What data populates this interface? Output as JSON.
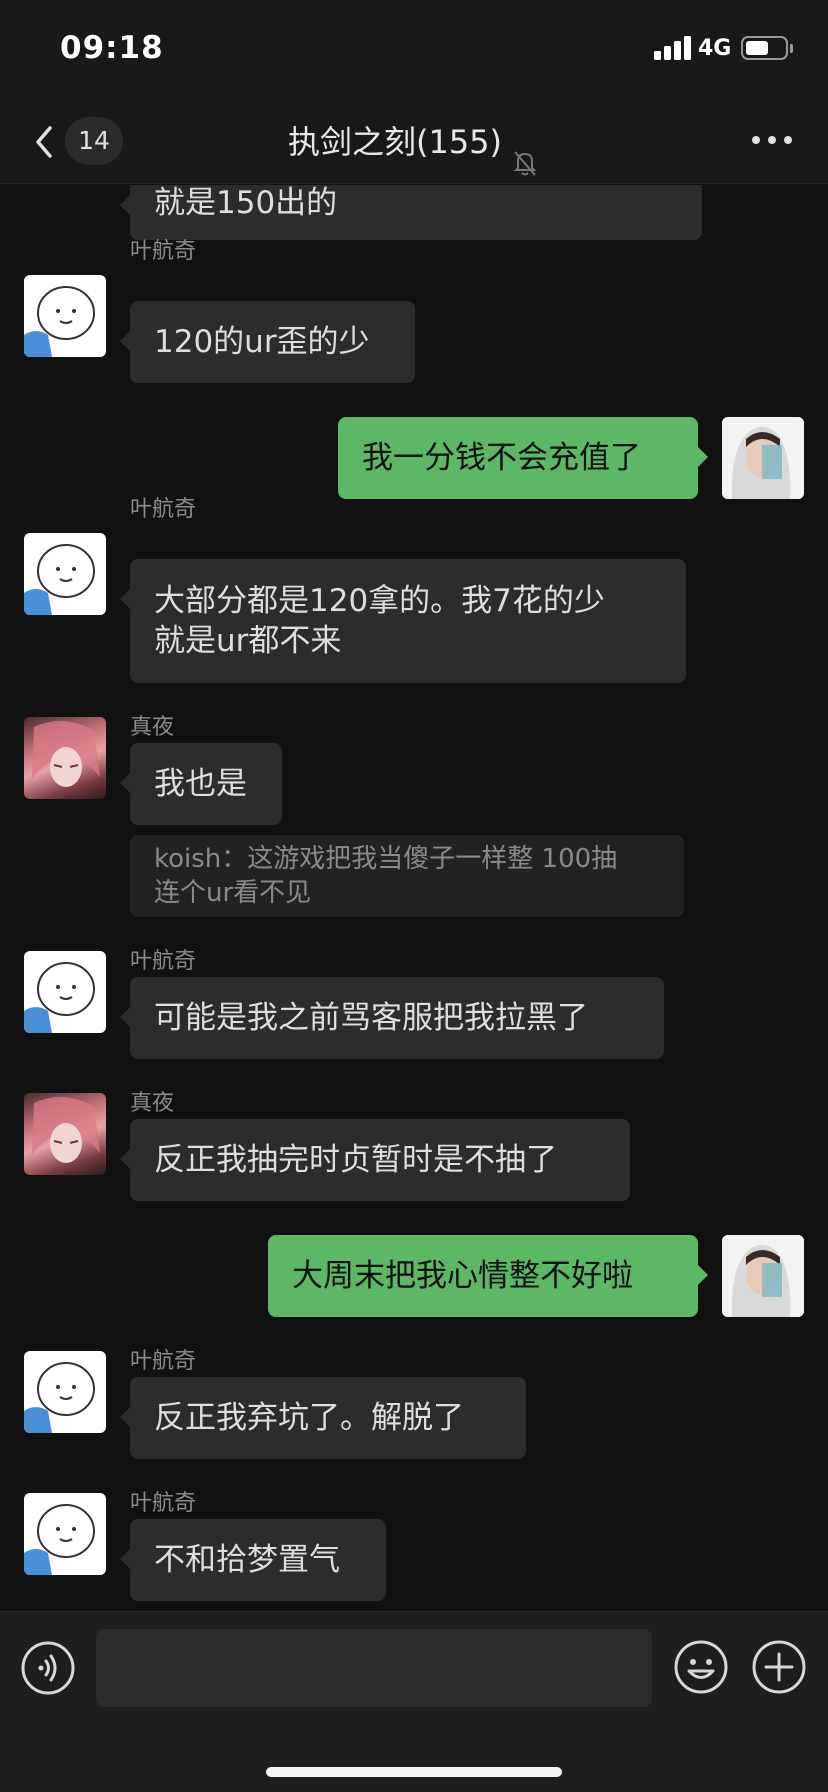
{
  "status_bar": {
    "time": "09:18",
    "network": "4G",
    "battery_level": 0.6
  },
  "nav": {
    "badge_count": "14",
    "title": "执剑之刻(155)",
    "mute_icon": "bell-slash-icon",
    "more_icon": "ellipsis-icon",
    "back_icon": "chevron-left-icon"
  },
  "messages": [
    {
      "side": "in",
      "sender": "",
      "lines": [
        "就是150出的"
      ]
    },
    {
      "side": "in",
      "sender": "叶航奇",
      "lines": [
        "120的ur歪的少"
      ]
    },
    {
      "side": "out",
      "sender": "",
      "lines": [
        "我一分钱不会充值了"
      ]
    },
    {
      "side": "in",
      "sender": "叶航奇",
      "lines": [
        "大部分都是120拿的。我7花的少",
        "就是ur都不来"
      ]
    },
    {
      "side": "in",
      "sender": "真夜",
      "lines": [
        "我也是"
      ],
      "quote": [
        "koish：这游戏把我当傻子一样整  100抽",
        "连个ur看不见"
      ]
    },
    {
      "side": "in",
      "sender": "叶航奇",
      "lines": [
        "可能是我之前骂客服把我拉黑了"
      ]
    },
    {
      "side": "in",
      "sender": "真夜",
      "lines": [
        "反正我抽完时贞暂时是不抽了"
      ]
    },
    {
      "side": "out",
      "sender": "",
      "lines": [
        "大周末把我心情整不好啦"
      ]
    },
    {
      "side": "in",
      "sender": "叶航奇",
      "lines": [
        "反正我弃坑了。解脱了"
      ]
    },
    {
      "side": "in",
      "sender": "叶航奇",
      "lines": [
        "不和拾梦置气"
      ]
    }
  ],
  "input_bar": {
    "voice_icon": "voice-icon",
    "emoji_icon": "smiley-icon",
    "add_icon": "plus-circle-icon"
  },
  "colors": {
    "background": "#111111",
    "bubble_in": "#2c2c2c",
    "bubble_out": "#5cb865",
    "sender_text": "#8a8a8a"
  }
}
